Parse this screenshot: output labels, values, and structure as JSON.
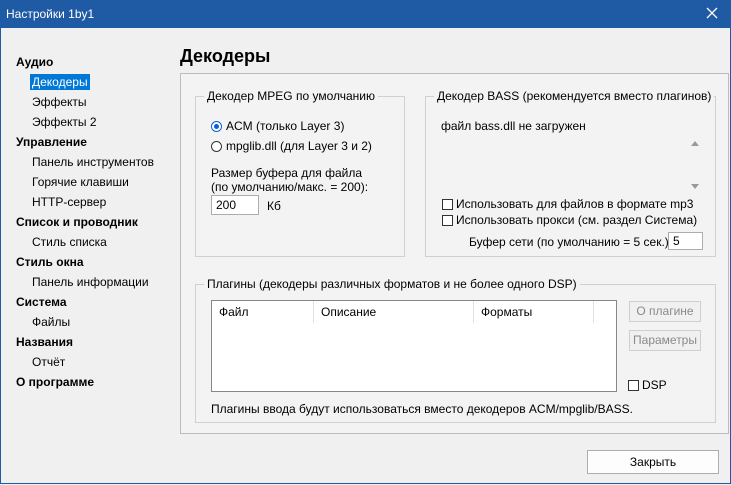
{
  "window": {
    "title": "Настройки 1by1"
  },
  "nav": {
    "audio": "Аудио",
    "decoders": "Декодеры",
    "effects": "Эффекты",
    "effects2": "Эффекты 2",
    "control": "Управление",
    "toolbar": "Панель инструментов",
    "hotkeys": "Горячие клавиши",
    "http": "HTTP-сервер",
    "list_explorer": "Список и проводник",
    "list_style": "Стиль списка",
    "window_style": "Стиль окна",
    "info_panel": "Панель информации",
    "system": "Система",
    "files": "Файлы",
    "names": "Названия",
    "report": "Отчёт",
    "about": "О программе"
  },
  "page_title": "Декодеры",
  "mpeg": {
    "legend": "Декодер MPEG по умолчанию",
    "acm": "ACM (только Layer 3)",
    "mpglib": "mpglib.dll (для Layer 3 и 2)",
    "buffer_label1": "Размер буфера для файла",
    "buffer_label2": "(по умолчанию/макс. = 200):",
    "buffer_value": "200",
    "buffer_unit": "Кб"
  },
  "bass": {
    "legend": "Декодер BASS (рекомендуется вместо плагинов)",
    "status": "файл bass.dll не загружен",
    "use_mp3": "Использовать для файлов в формате mp3",
    "use_proxy": "Использовать прокси (см. раздел Система)",
    "net_buffer_label": "Буфер сети (по умолчанию = 5 сек.):",
    "net_buffer_value": "5"
  },
  "plugins": {
    "legend": "Плагины (декодеры различных форматов и не более одного DSP)",
    "col_file": "Файл",
    "col_desc": "Описание",
    "col_formats": "Форматы",
    "about_btn": "О плагине",
    "params_btn": "Параметры",
    "dsp": "DSP",
    "note": "Плагины ввода будут использоваться вместо декодеров ACM/mpglib/BASS."
  },
  "close_btn": "Закрыть"
}
